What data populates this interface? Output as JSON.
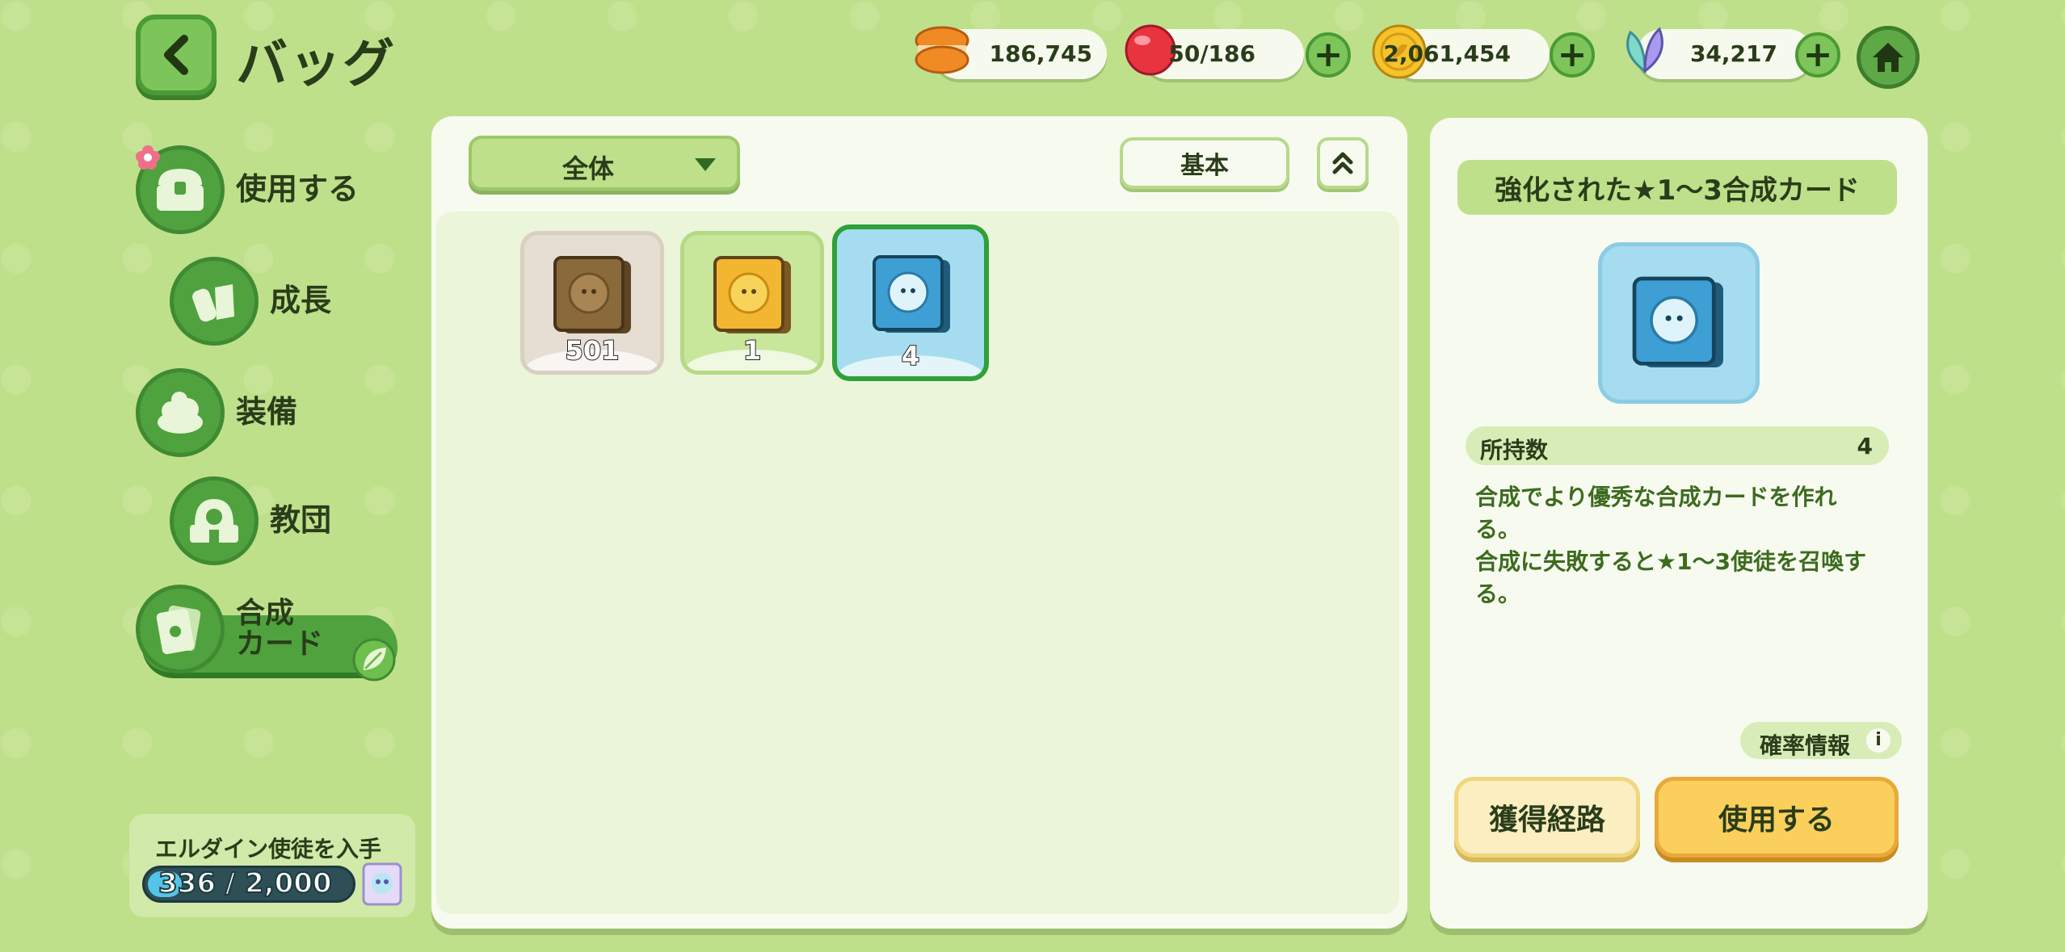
{
  "header": {
    "back_icon": "chevron-left-icon",
    "title": "バッグ",
    "resources": [
      {
        "icon": "macaron-icon",
        "value": "186,745",
        "has_plus": false
      },
      {
        "icon": "red-candy-icon",
        "value": "50/186",
        "has_plus": true
      },
      {
        "icon": "gold-coin-icon",
        "value": "2,061,454",
        "has_plus": true
      },
      {
        "icon": "crystal-leaf-icon",
        "value": "34,217",
        "has_plus": true
      }
    ],
    "plus_label": "+",
    "home_icon": "home-icon"
  },
  "sidebar": {
    "items": [
      {
        "label": "使用する",
        "icon": "chest-icon",
        "active": false,
        "badge": "flower-badge"
      },
      {
        "label": "成長",
        "icon": "potion-icon",
        "active": false
      },
      {
        "label": "装備",
        "icon": "cream-puff-icon",
        "active": false
      },
      {
        "label": "教団",
        "icon": "temple-icon",
        "active": false
      },
      {
        "label_line1": "合成",
        "label_line2": "カード",
        "icon": "card-icon",
        "active": true
      }
    ],
    "quest": {
      "title": "エルダイン使徒を入手",
      "progress_text": "336 / 2,000",
      "current": 336,
      "total": 2000,
      "reward_icon": "prism-card-icon"
    }
  },
  "main": {
    "filter": {
      "selected": "全体"
    },
    "sort_label": "基本",
    "order_icon": "double-chevron-up-icon",
    "items": [
      {
        "name": "bronze-card",
        "count": "501",
        "bg": "#e6ddd3",
        "border": "#d9cfc3",
        "card_color": "#8a6a3a",
        "selected": false
      },
      {
        "name": "gold-card",
        "count": "1",
        "bg": "#c8e79a",
        "border": "#b4d987",
        "card_color": "#f2b630",
        "selected": false
      },
      {
        "name": "blue-card",
        "count": "4",
        "bg": "#a6dcef",
        "border": "#2fa03a",
        "card_color": "#3e9fd4",
        "selected": true
      }
    ]
  },
  "detail": {
    "title": "強化された★1～3合成カード",
    "owned_label": "所持数",
    "owned_value": "4",
    "description_lines": [
      "合成でより優秀な合成カードを作れ",
      "る。",
      "合成に失敗すると★1～3使徒を召喚す",
      "る。"
    ],
    "probability_label": "確率情報",
    "info_icon_text": "i",
    "route_button": "獲得経路",
    "use_button": "使用する"
  },
  "colors": {
    "background": "#bfe08a",
    "accent_green": "#4fa23e",
    "panel": "#f7fbef",
    "use_button": "#fbcf5c"
  }
}
